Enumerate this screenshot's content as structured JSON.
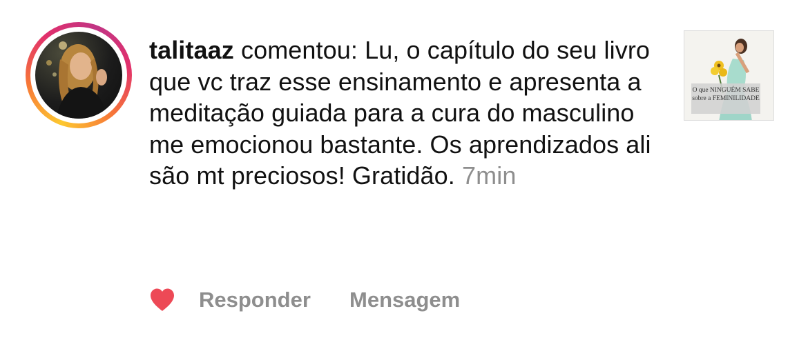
{
  "comment": {
    "username": "talitaaz",
    "text": "comentou: Lu, o capítulo do seu livro que vc traz esse ensinamento e apresenta a meditação guiada para a cura do masculino me emocionou bastante. Os aprendizados ali são mt preciosos! Gratidão.",
    "time": "7min"
  },
  "post_thumbnail": {
    "caption": "O que NINGUÉM SABE sobre a FEMINILIDADE"
  },
  "actions": {
    "like_icon": "heart-icon",
    "like_color": "#ed4956",
    "reply_label": "Responder",
    "message_label": "Mensagem"
  },
  "colors": {
    "secondary_text": "#8e8e8e",
    "story_ring": [
      "#fdc830",
      "#f77737",
      "#e1306c",
      "#c13584"
    ]
  }
}
